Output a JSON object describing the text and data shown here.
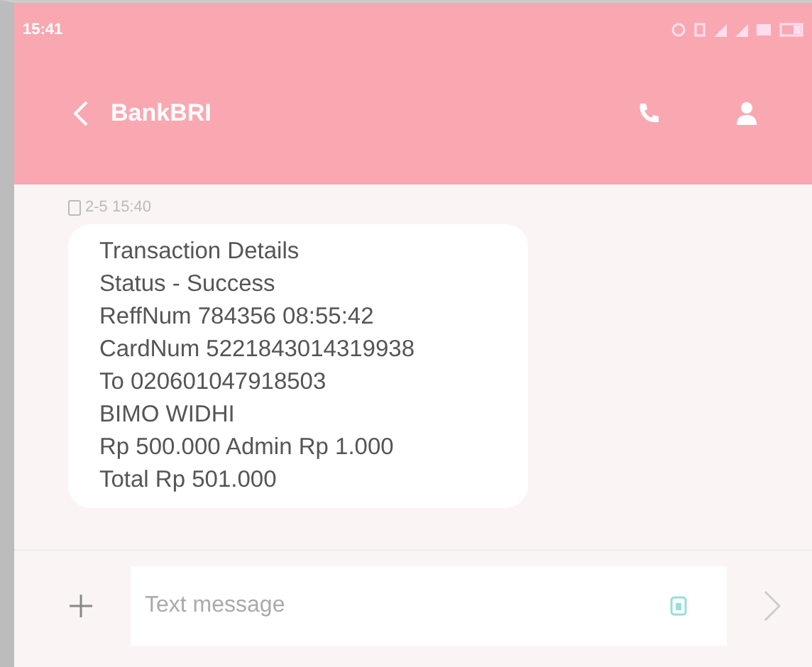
{
  "status_bar": {
    "time": "15:41"
  },
  "header": {
    "title": "BankBRI"
  },
  "messages": [
    {
      "timestamp": "2-5 15:40",
      "lines": [
        "Transaction Details",
        "Status - Success",
        "ReffNum 784356 08:55:42",
        "CardNum 5221843014319938",
        "To 020601047918503",
        "BIMO WIDHI",
        "Rp 500.000 Admin Rp 1.000",
        "Total Rp 501.000"
      ]
    }
  ],
  "composer": {
    "placeholder": "Text message"
  }
}
